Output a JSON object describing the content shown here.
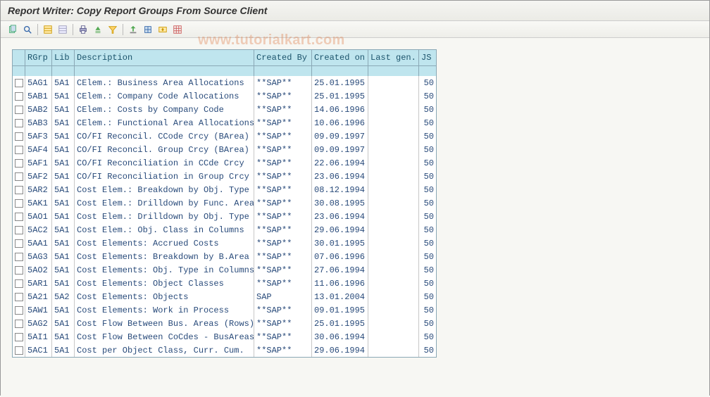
{
  "title": "Report Writer: Copy Report Groups From Source Client",
  "watermark": "www.tutorialkart.com",
  "toolbar": {
    "buttons": [
      {
        "name": "copy-icon",
        "sep": false
      },
      {
        "name": "display-icon",
        "sep": false
      },
      {
        "name": "",
        "sep": true
      },
      {
        "name": "select-all-icon",
        "sep": false
      },
      {
        "name": "deselect-icon",
        "sep": false
      },
      {
        "name": "",
        "sep": true
      },
      {
        "name": "print-icon",
        "sep": false
      },
      {
        "name": "sort-asc-icon",
        "sep": false
      },
      {
        "name": "filter-icon",
        "sep": false
      },
      {
        "name": "",
        "sep": true
      },
      {
        "name": "export-icon",
        "sep": false
      },
      {
        "name": "settings-icon",
        "sep": false
      },
      {
        "name": "variant-icon",
        "sep": false
      },
      {
        "name": "layout-icon",
        "sep": false
      }
    ]
  },
  "columns": [
    {
      "key": "chk",
      "label": "",
      "cls": "chkcell"
    },
    {
      "key": "rgrp",
      "label": "RGrp",
      "cls": "col-rgrp"
    },
    {
      "key": "lib",
      "label": "Lib",
      "cls": "col-lib"
    },
    {
      "key": "desc",
      "label": "Description",
      "cls": "col-desc"
    },
    {
      "key": "cby",
      "label": "Created By",
      "cls": "col-cby"
    },
    {
      "key": "con",
      "label": "Created on",
      "cls": "col-con"
    },
    {
      "key": "lgen",
      "label": "Last gen.",
      "cls": "col-lgen"
    },
    {
      "key": "js",
      "label": "JS",
      "cls": "col-js"
    }
  ],
  "rows": [
    {
      "rgrp": "5AG1",
      "lib": "5A1",
      "desc": "CElem.: Business Area Allocations",
      "cby": "**SAP**",
      "con": "25.01.1995",
      "lgen": "",
      "js": "50"
    },
    {
      "rgrp": "5AB1",
      "lib": "5A1",
      "desc": "CElem.: Company Code Allocations",
      "cby": "**SAP**",
      "con": "25.01.1995",
      "lgen": "",
      "js": "50"
    },
    {
      "rgrp": "5AB2",
      "lib": "5A1",
      "desc": "CElem.: Costs by Company Code",
      "cby": "**SAP**",
      "con": "14.06.1996",
      "lgen": "",
      "js": "50"
    },
    {
      "rgrp": "5AB3",
      "lib": "5A1",
      "desc": "CElem.: Functional Area Allocations",
      "cby": "**SAP**",
      "con": "10.06.1996",
      "lgen": "",
      "js": "50"
    },
    {
      "rgrp": "5AF3",
      "lib": "5A1",
      "desc": "CO/FI Reconcil. CCode Crcy (BArea)",
      "cby": "**SAP**",
      "con": "09.09.1997",
      "lgen": "",
      "js": "50"
    },
    {
      "rgrp": "5AF4",
      "lib": "5A1",
      "desc": "CO/FI Reconcil. Group Crcy (BArea)",
      "cby": "**SAP**",
      "con": "09.09.1997",
      "lgen": "",
      "js": "50"
    },
    {
      "rgrp": "5AF1",
      "lib": "5A1",
      "desc": "CO/FI Reconciliation in CCde Crcy",
      "cby": "**SAP**",
      "con": "22.06.1994",
      "lgen": "",
      "js": "50"
    },
    {
      "rgrp": "5AF2",
      "lib": "5A1",
      "desc": "CO/FI Reconciliation in Group Crcy",
      "cby": "**SAP**",
      "con": "23.06.1994",
      "lgen": "",
      "js": "50"
    },
    {
      "rgrp": "5AR2",
      "lib": "5A1",
      "desc": "Cost Elem.: Breakdown by Obj. Type",
      "cby": "**SAP**",
      "con": "08.12.1994",
      "lgen": "",
      "js": "50"
    },
    {
      "rgrp": "5AK1",
      "lib": "5A1",
      "desc": "Cost Elem.: Drilldown by Func. Area",
      "cby": "**SAP**",
      "con": "30.08.1995",
      "lgen": "",
      "js": "50"
    },
    {
      "rgrp": "5AO1",
      "lib": "5A1",
      "desc": "Cost Elem.: Drilldown by Obj. Type",
      "cby": "**SAP**",
      "con": "23.06.1994",
      "lgen": "",
      "js": "50"
    },
    {
      "rgrp": "5AC2",
      "lib": "5A1",
      "desc": "Cost Elem.: Obj. Class in Columns",
      "cby": "**SAP**",
      "con": "29.06.1994",
      "lgen": "",
      "js": "50"
    },
    {
      "rgrp": "5AA1",
      "lib": "5A1",
      "desc": "Cost Elements: Accrued Costs",
      "cby": "**SAP**",
      "con": "30.01.1995",
      "lgen": "",
      "js": "50"
    },
    {
      "rgrp": "5AG3",
      "lib": "5A1",
      "desc": "Cost Elements: Breakdown by B.Area",
      "cby": "**SAP**",
      "con": "07.06.1996",
      "lgen": "",
      "js": "50"
    },
    {
      "rgrp": "5AO2",
      "lib": "5A1",
      "desc": "Cost Elements: Obj. Type in Columns",
      "cby": "**SAP**",
      "con": "27.06.1994",
      "lgen": "",
      "js": "50"
    },
    {
      "rgrp": "5AR1",
      "lib": "5A1",
      "desc": "Cost Elements: Object Classes",
      "cby": "**SAP**",
      "con": "11.06.1996",
      "lgen": "",
      "js": "50"
    },
    {
      "rgrp": "5A21",
      "lib": "5A2",
      "desc": "Cost Elements: Objects",
      "cby": "SAP",
      "con": "13.01.2004",
      "lgen": "",
      "js": "50"
    },
    {
      "rgrp": "5AW1",
      "lib": "5A1",
      "desc": "Cost Elements: Work in Process",
      "cby": "**SAP**",
      "con": "09.01.1995",
      "lgen": "",
      "js": "50"
    },
    {
      "rgrp": "5AG2",
      "lib": "5A1",
      "desc": "Cost Flow Between Bus. Areas (Rows)",
      "cby": "**SAP**",
      "con": "25.01.1995",
      "lgen": "",
      "js": "50"
    },
    {
      "rgrp": "5AI1",
      "lib": "5A1",
      "desc": "Cost Flow Between CoCdes - BusAreas",
      "cby": "**SAP**",
      "con": "30.06.1994",
      "lgen": "",
      "js": "50"
    },
    {
      "rgrp": "5AC1",
      "lib": "5A1",
      "desc": "Cost per Object Class, Curr. Cum.",
      "cby": "**SAP**",
      "con": "29.06.1994",
      "lgen": "",
      "js": "50"
    }
  ]
}
